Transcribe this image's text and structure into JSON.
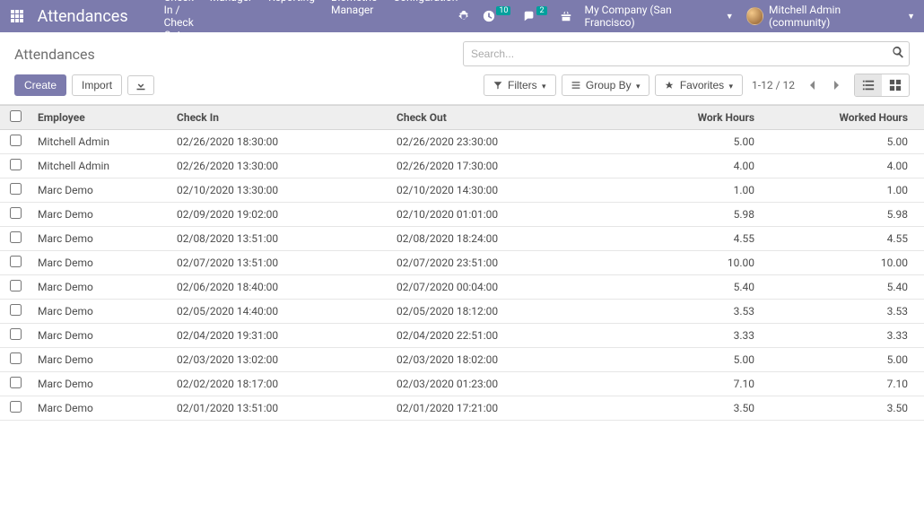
{
  "navbar": {
    "brand": "Attendances",
    "menu": [
      "Check In / Check Out",
      "Manager",
      "Reporting",
      "Biometric Manager",
      "Configuration"
    ],
    "badge_activities": "10",
    "badge_messages": "2",
    "company": "My Company (San Francisco)",
    "user": "Mitchell Admin (community)"
  },
  "breadcrumb": "Attendances",
  "search": {
    "placeholder": "Search..."
  },
  "buttons": {
    "create": "Create",
    "import": "Import",
    "filters": "Filters",
    "groupby": "Group By",
    "favorites": "Favorites"
  },
  "pager": {
    "range": "1-12 / 12"
  },
  "table": {
    "headers": {
      "employee": "Employee",
      "checkin": "Check In",
      "checkout": "Check Out",
      "work_hours": "Work Hours",
      "worked_hours": "Worked Hours"
    },
    "rows": [
      {
        "employee": "Mitchell Admin",
        "checkin": "02/26/2020 18:30:00",
        "checkout": "02/26/2020 23:30:00",
        "work_hours": "5.00",
        "worked_hours": "5.00"
      },
      {
        "employee": "Mitchell Admin",
        "checkin": "02/26/2020 13:30:00",
        "checkout": "02/26/2020 17:30:00",
        "work_hours": "4.00",
        "worked_hours": "4.00"
      },
      {
        "employee": "Marc Demo",
        "checkin": "02/10/2020 13:30:00",
        "checkout": "02/10/2020 14:30:00",
        "work_hours": "1.00",
        "worked_hours": "1.00"
      },
      {
        "employee": "Marc Demo",
        "checkin": "02/09/2020 19:02:00",
        "checkout": "02/10/2020 01:01:00",
        "work_hours": "5.98",
        "worked_hours": "5.98"
      },
      {
        "employee": "Marc Demo",
        "checkin": "02/08/2020 13:51:00",
        "checkout": "02/08/2020 18:24:00",
        "work_hours": "4.55",
        "worked_hours": "4.55"
      },
      {
        "employee": "Marc Demo",
        "checkin": "02/07/2020 13:51:00",
        "checkout": "02/07/2020 23:51:00",
        "work_hours": "10.00",
        "worked_hours": "10.00"
      },
      {
        "employee": "Marc Demo",
        "checkin": "02/06/2020 18:40:00",
        "checkout": "02/07/2020 00:04:00",
        "work_hours": "5.40",
        "worked_hours": "5.40"
      },
      {
        "employee": "Marc Demo",
        "checkin": "02/05/2020 14:40:00",
        "checkout": "02/05/2020 18:12:00",
        "work_hours": "3.53",
        "worked_hours": "3.53"
      },
      {
        "employee": "Marc Demo",
        "checkin": "02/04/2020 19:31:00",
        "checkout": "02/04/2020 22:51:00",
        "work_hours": "3.33",
        "worked_hours": "3.33"
      },
      {
        "employee": "Marc Demo",
        "checkin": "02/03/2020 13:02:00",
        "checkout": "02/03/2020 18:02:00",
        "work_hours": "5.00",
        "worked_hours": "5.00"
      },
      {
        "employee": "Marc Demo",
        "checkin": "02/02/2020 18:17:00",
        "checkout": "02/03/2020 01:23:00",
        "work_hours": "7.10",
        "worked_hours": "7.10"
      },
      {
        "employee": "Marc Demo",
        "checkin": "02/01/2020 13:51:00",
        "checkout": "02/01/2020 17:21:00",
        "work_hours": "3.50",
        "worked_hours": "3.50"
      }
    ]
  }
}
